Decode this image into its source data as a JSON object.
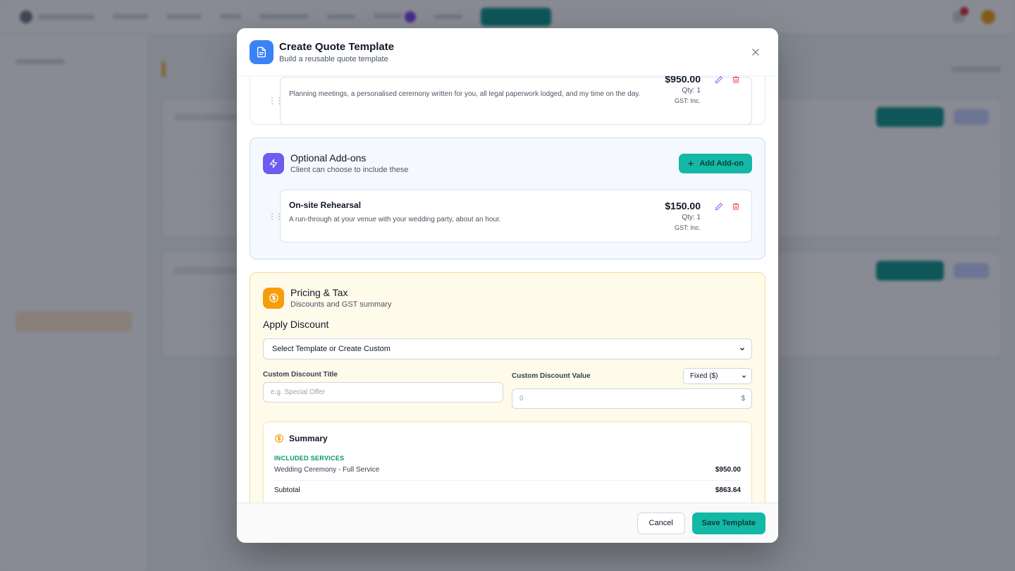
{
  "modal": {
    "title": "Create Quote Template",
    "subtitle": "Build a reusable quote template"
  },
  "included_item": {
    "price": "$950.00",
    "description": "Planning meetings, a personalised ceremony written for you, all legal paperwork lodged, and my time on the day.",
    "qty": "Qty: 1",
    "gst": "GST: Inc."
  },
  "addons": {
    "title": "Optional Add-ons",
    "subtitle": "Client can choose to include these",
    "add_button": "Add Add-on",
    "items": [
      {
        "name": "On-site Rehearsal",
        "description": "A run-through at your venue with your wedding party, about an hour.",
        "price": "$150.00",
        "qty": "Qty: 1",
        "gst": "GST: Inc."
      }
    ]
  },
  "pricing": {
    "title": "Pricing & Tax",
    "subtitle": "Discounts and GST summary",
    "apply_discount": "Apply Discount",
    "discount_select": "Select Template or Create Custom",
    "custom_title_label": "Custom Discount Title",
    "custom_title_placeholder": "e.g. Special Offer",
    "custom_value_label": "Custom Discount Value",
    "value_type": "Fixed ($)",
    "value_placeholder": "0",
    "value_suffix": "$"
  },
  "summary": {
    "title": "Summary",
    "section_label": "INCLUDED SERVICES",
    "rows": [
      {
        "label": "Wedding Ceremony - Full Service",
        "amount": "$950.00"
      }
    ],
    "subtotal_label": "Subtotal",
    "subtotal_amount": "$863.64"
  },
  "footer": {
    "cancel": "Cancel",
    "save": "Save Template"
  },
  "colors": {
    "accent_teal": "#14b8a6",
    "header_blue": "#3b82f6",
    "addon_violet": "#6d5cf0",
    "pricing_orange": "#f59e0b",
    "delete_red": "#ef4444",
    "edit_purple": "#8b5cf6"
  }
}
